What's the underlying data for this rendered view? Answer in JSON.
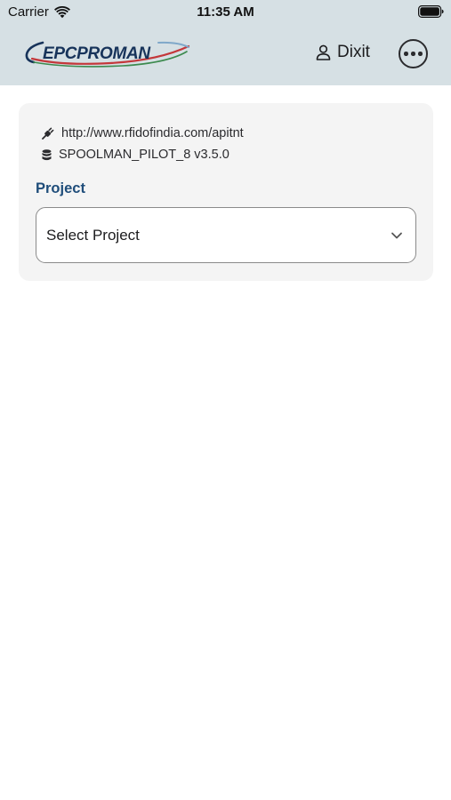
{
  "status_bar": {
    "carrier": "Carrier",
    "time": "11:35 AM"
  },
  "header": {
    "logo_text": "EPCPROMAN",
    "user_name": "Dixit",
    "bg_color": "#d6e0e4"
  },
  "connection": {
    "url": "http://www.rfidofindia.com/apitnt",
    "database": "SPOOLMAN_PILOT_8 v3.5.0"
  },
  "project": {
    "label": "Project",
    "placeholder": "Select Project",
    "label_color": "#1f4d7a"
  },
  "icons": {
    "wifi": "wifi-icon",
    "battery": "battery-icon",
    "user": "user-icon",
    "more": "more-options-icon",
    "plug": "plug-icon",
    "database": "database-icon",
    "chevron": "chevron-down-icon"
  }
}
